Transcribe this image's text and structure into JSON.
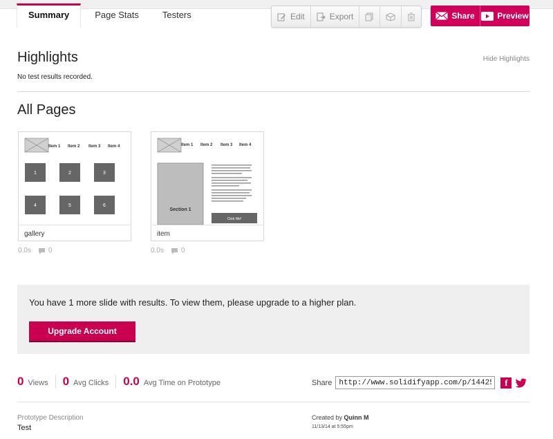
{
  "tabs": [
    {
      "label": "Summary",
      "active": true
    },
    {
      "label": "Page Stats",
      "active": false
    },
    {
      "label": "Testers",
      "active": false
    }
  ],
  "toolbar": {
    "edit_label": "Edit",
    "export_label": "Export",
    "icons": [
      "copy-icon",
      "package-icon",
      "trash-icon"
    ]
  },
  "share_group": {
    "share_label": "Share",
    "preview_label": "Preview",
    "color": "#d0005a"
  },
  "highlights": {
    "title": "Highlights",
    "hide_label": "Hide Highlights",
    "empty_text": "No test results recorded."
  },
  "all_pages": {
    "title": "All Pages",
    "pages": [
      {
        "caption": "gallery",
        "time": "0.0s",
        "comments": "0",
        "thumb": {
          "nav": [
            "Item 1",
            "Item 2",
            "Item 3",
            "Item 4"
          ],
          "tiles": [
            "1",
            "2",
            "3",
            "4",
            "5",
            "6"
          ]
        }
      },
      {
        "caption": "item",
        "time": "0.0s",
        "comments": "0",
        "thumb": {
          "nav": [
            "Item 1",
            "Item 2",
            "Item 3",
            "Item 4"
          ],
          "section_label": "Section 1",
          "button_label": "Click Me!"
        }
      }
    ]
  },
  "upgrade": {
    "message": "You have 1 more slide with results. To view them, please upgrade to a higher plan.",
    "button_label": "Upgrade Account"
  },
  "stats": {
    "views": {
      "value": "0",
      "label": "Views"
    },
    "avg_clicks": {
      "value": "0",
      "label": "Avg Clicks"
    },
    "avg_time": {
      "value": "0.0",
      "label": "Avg Time on Prototype"
    }
  },
  "share": {
    "label": "Share",
    "url": "http://www.solidifyapp.com/p/14425"
  },
  "description": {
    "label": "Prototype Description",
    "value": "Test"
  },
  "created": {
    "prefix": "Created by",
    "author": "Quinn M",
    "date": "11/13/14 at 5:55pm"
  },
  "colors": {
    "accent": "#c8004f",
    "panel": "#efefef"
  }
}
